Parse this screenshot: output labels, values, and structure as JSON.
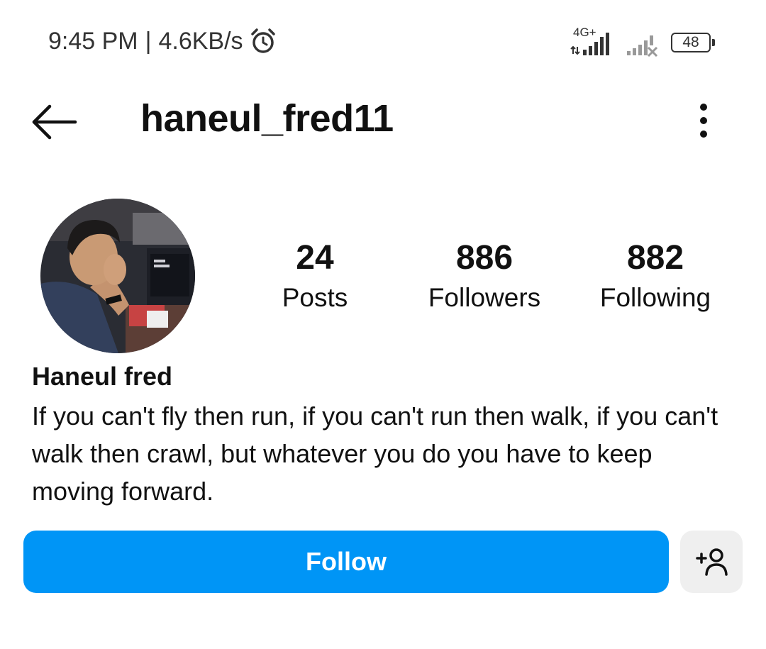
{
  "status_bar": {
    "time": "9:45 PM",
    "separator": "|",
    "network_speed": "4.6KB/s",
    "network_type": "4G+",
    "battery_level": "48",
    "icons": [
      "alarm-icon",
      "signal-icon",
      "signal-no-service-icon",
      "battery-icon"
    ]
  },
  "header": {
    "username": "haneul_fred11",
    "icons": [
      "back-arrow-icon",
      "more-options-icon"
    ]
  },
  "profile": {
    "stats": [
      {
        "count": "24",
        "label": "Posts"
      },
      {
        "count": "886",
        "label": "Followers"
      },
      {
        "count": "882",
        "label": "Following"
      }
    ],
    "display_name": "Haneul fred",
    "bio": "If you can't fly then run, if you can't run then walk, if you can't walk then crawl, but whatever you do you have to keep moving forward."
  },
  "actions": {
    "follow_label": "Follow",
    "suggest_icon": "add-person-icon"
  },
  "colors": {
    "accent": "#0095f6",
    "secondary_button": "#efefef",
    "text": "#111111"
  }
}
